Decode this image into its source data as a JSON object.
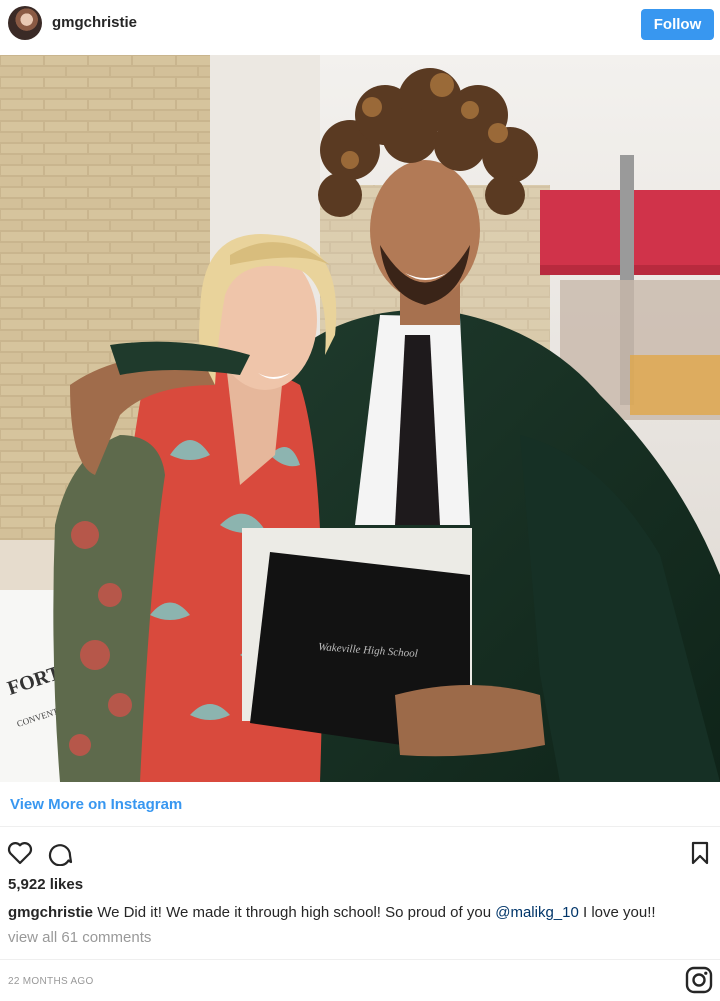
{
  "header": {
    "username": "gmgchristie",
    "follow_label": "Follow",
    "avatar_icon": "profile-avatar"
  },
  "photo": {
    "diploma_text": "Wakeville High School",
    "sign_text_line1": "FORT W",
    "sign_text_line2": "CONVENTION"
  },
  "link": {
    "view_more": "View More on Instagram"
  },
  "actions": {
    "like_icon": "heart-icon",
    "comment_icon": "comment-icon",
    "save_icon": "bookmark-icon"
  },
  "stats": {
    "likes_count": "5,922",
    "likes_word": "likes"
  },
  "caption": {
    "user": "gmgchristie",
    "text_before": "We Did it! We made it through high school! So proud of you",
    "mention": "@malikg_10",
    "text_after": "I love you!!"
  },
  "comments": {
    "view_all": "view all 61 comments"
  },
  "timestamp": "22 MONTHS AGO",
  "colors": {
    "accent": "#3897f0",
    "text": "#262626",
    "muted": "#999999",
    "mention": "#003569"
  }
}
